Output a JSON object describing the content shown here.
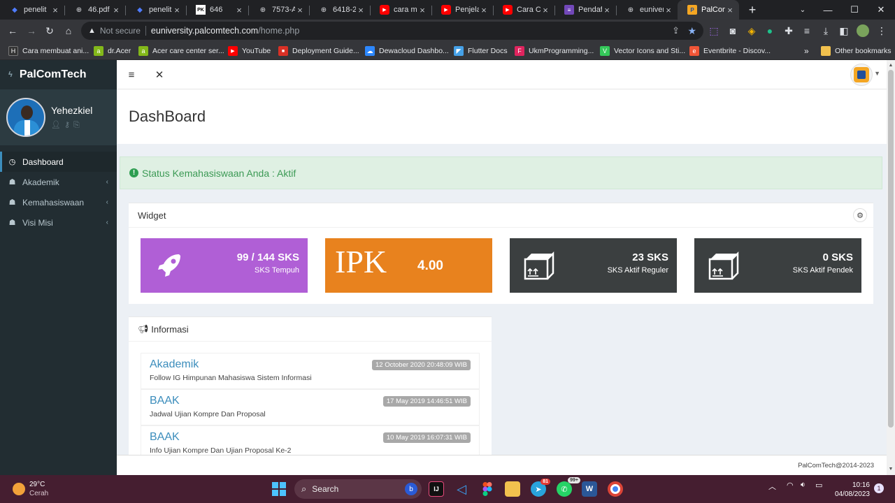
{
  "browser": {
    "tabs": [
      {
        "label": "penelit",
        "icon": "gem-icon"
      },
      {
        "label": "46.pdf",
        "icon": "globe-icon"
      },
      {
        "label": "penelit",
        "icon": "gem-icon"
      },
      {
        "label": "646",
        "icon": "pdf-icon"
      },
      {
        "label": "7573-A",
        "icon": "globe-icon"
      },
      {
        "label": "6418-2",
        "icon": "globe-icon"
      },
      {
        "label": "cara me",
        "icon": "youtube-icon"
      },
      {
        "label": "Penjela",
        "icon": "youtube-icon"
      },
      {
        "label": "Cara Ce",
        "icon": "youtube-icon"
      },
      {
        "label": "Pendaft",
        "icon": "form-icon"
      },
      {
        "label": "euniver",
        "icon": "globe-icon"
      },
      {
        "label": "PalCom",
        "icon": "palcom-icon",
        "active": true
      }
    ],
    "close_glyph": "×",
    "new_tab_glyph": "+",
    "omnibox": {
      "security": "Not secure",
      "host": "euniversity.palcomtech.com",
      "path": "/home.php"
    },
    "bookmarks": [
      {
        "label": "Cara membuat ani...",
        "color": "#333333",
        "icon_text": "H"
      },
      {
        "label": "dr.Acer",
        "color": "#83b81a",
        "icon_text": "a"
      },
      {
        "label": "Acer care center ser...",
        "color": "#83b81a",
        "icon_text": "a"
      },
      {
        "label": "YouTube",
        "color": "#ff0000",
        "icon_text": "▶"
      },
      {
        "label": "Deployment Guide...",
        "color": "#d93025",
        "icon_text": "■"
      },
      {
        "label": "Dewacloud Dashbo...",
        "color": "#2d88ff",
        "icon_text": "☁"
      },
      {
        "label": "Flutter Docs",
        "color": "#45a1e8",
        "icon_text": "◤"
      },
      {
        "label": "UkmProgramming...",
        "color": "#e0245e",
        "icon_text": "F"
      },
      {
        "label": "Vector Icons and Sti...",
        "color": "#34c759",
        "icon_text": "V"
      },
      {
        "label": "Eventbrite - Discov...",
        "color": "#f05537",
        "icon_text": "e"
      }
    ],
    "bookmarks_more": "»",
    "other_bookmarks": "Other bookmarks"
  },
  "app": {
    "brand": "PalComTech",
    "user": {
      "name": "Yehezkiel"
    },
    "sidebar": [
      {
        "label": "Dashboard",
        "icon": "dashboard-icon",
        "active": true
      },
      {
        "label": "Akademik",
        "icon": "graduation-icon"
      },
      {
        "label": "Kemahasiswaan",
        "icon": "graduation-icon"
      },
      {
        "label": "Visi Misi",
        "icon": "graduation-icon"
      }
    ],
    "page_title": "DashBoard",
    "alert": "Status Kemahasiswaan Anda : Aktif",
    "widget": {
      "title": "Widget",
      "tiles": [
        {
          "value": "99 / 144 SKS",
          "label": "SKS Tempuh",
          "color": "#b05fd6",
          "icon": "rocket-icon"
        },
        {
          "value": "4.00",
          "label": "IPK",
          "color": "#e8821e",
          "icon": "ipk-text"
        },
        {
          "value": "23 SKS",
          "label": "SKS Aktif Reguler",
          "color": "#3b3f40",
          "icon": "boxes-icon"
        },
        {
          "value": "0 SKS",
          "label": "SKS Aktif Pendek",
          "color": "#3b3f40",
          "icon": "boxes-icon"
        }
      ]
    },
    "informasi": {
      "title": "Informasi",
      "items": [
        {
          "title": "Akademik",
          "desc": "Follow IG Himpunan Mahasiswa Sistem Informasi",
          "date": "12 October 2020 20:48:09 WIB"
        },
        {
          "title": "BAAK",
          "desc": "Jadwal Ujian Kompre Dan Proposal",
          "date": "17 May 2019 14:46:51 WIB"
        },
        {
          "title": "BAAK",
          "desc": "Info Ujian Kompre Dan Ujian Proposal Ke-2",
          "date": "10 May 2019 16:07:31 WIB"
        }
      ]
    },
    "footer": "PalComTech@2014-2023"
  },
  "taskbar": {
    "weather": {
      "temp": "29°C",
      "desc": "Cerah"
    },
    "search": "Search",
    "telegram_badge": "81",
    "whatsapp_badge": "99+",
    "time": "10:16",
    "date": "04/08/2023",
    "notif_badge": "1"
  }
}
